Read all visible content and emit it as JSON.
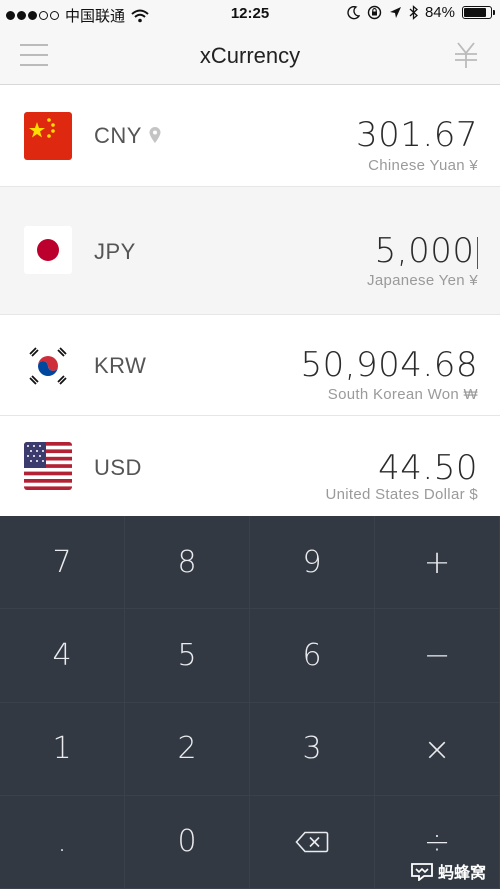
{
  "status_bar": {
    "carrier": "中国联通",
    "time": "12:25",
    "battery": "84%",
    "battery_level": 0.84,
    "icons": [
      "signal-dots-icon",
      "wifi-icon",
      "moon-icon",
      "rotation-lock-icon",
      "location-arrow-icon",
      "bluetooth-icon",
      "battery-icon"
    ]
  },
  "navbar": {
    "title": "xCurrency",
    "left_icon": "menu-icon",
    "right_icon": "yen-settings-icon"
  },
  "currencies": [
    {
      "code": "CNY",
      "amount": "301.67",
      "name": "Chinese Yuan ¥",
      "flag": "china-flag-icon",
      "home": true
    },
    {
      "code": "JPY",
      "amount": "5,000",
      "name": "Japanese Yen ¥",
      "flag": "japan-flag-icon",
      "active": true
    },
    {
      "code": "KRW",
      "amount": "50,904.68",
      "name": "South Korean Won ₩",
      "flag": "korea-flag-icon"
    },
    {
      "code": "USD",
      "amount": "44.50",
      "name": "United States Dollar $",
      "flag": "usa-flag-icon"
    }
  ],
  "keypad": {
    "keys": [
      "7",
      "8",
      "9",
      "+",
      "4",
      "5",
      "6",
      "−",
      "1",
      "2",
      "3",
      "×",
      ".",
      "0",
      "⌫",
      "÷"
    ],
    "background": "#333942"
  },
  "watermark": {
    "text": "蚂蜂窝"
  }
}
